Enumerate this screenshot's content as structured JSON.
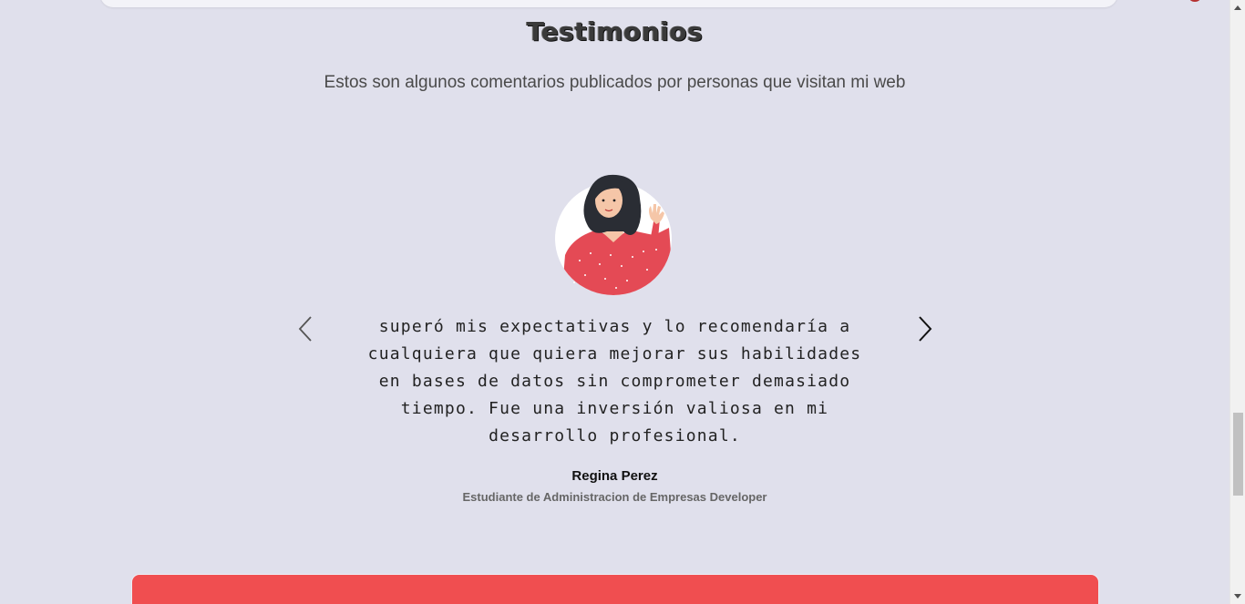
{
  "testimonials": {
    "title": "Testimonios",
    "subtitle": "Estos son algunos comentarios publicados por personas que visitan mi web",
    "quote": "superó mis expectativas y lo recomendaría a cualquiera que quiera mejorar sus habilidades en bases de datos sin comprometer demasiado tiempo. Fue una inversión valiosa en mi desarrollo profesional.",
    "author_name": "Regina Perez",
    "author_role": "Estudiante de Administracion de Empresas Developer",
    "prev_icon": "chevron-left-icon",
    "next_icon": "chevron-right-icon"
  },
  "colors": {
    "background": "#e0e0ec",
    "accent_red": "#f04e50",
    "text_dark": "#222222",
    "text_muted": "#666666"
  }
}
